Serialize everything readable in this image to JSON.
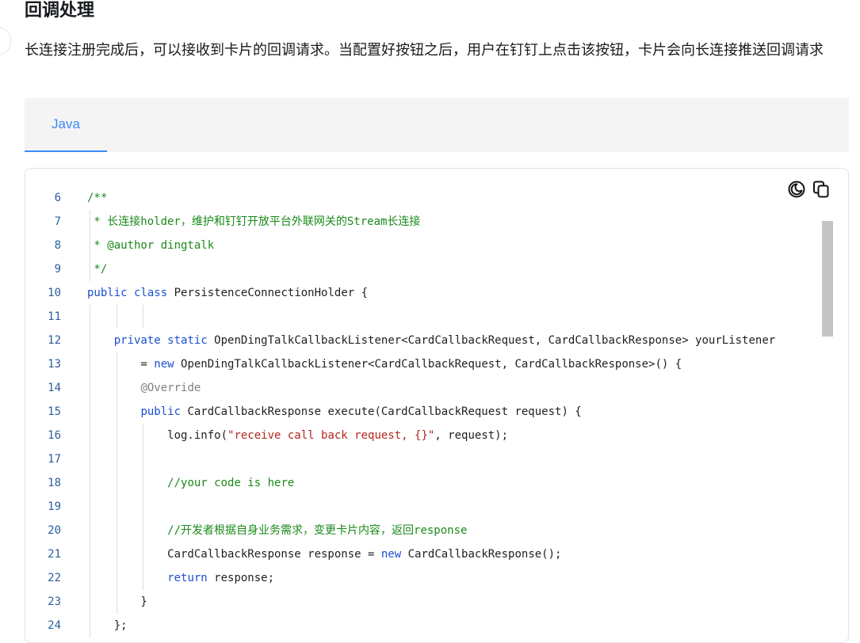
{
  "heading": "回调处理",
  "description": "长连接注册完成后，可以接收到卡片的回调请求。当配置好按钮之后，用户在钉钉上点击该按钮，卡片会向长连接推送回调请求",
  "tabs": [
    {
      "label": "Java",
      "active": true
    }
  ],
  "accent_color": "#3a8bf5",
  "toolbar": {
    "theme_icon": "theme-toggle-icon",
    "copy_icon": "copy-icon"
  },
  "code_lines": [
    {
      "n": "6",
      "tokens": [
        {
          "t": "/**",
          "c": "cm"
        }
      ]
    },
    {
      "n": "7",
      "tokens": [
        {
          "t": " * 长连接holder，维护和钉钉开放平台外联网关的Stream长连接",
          "c": "cm"
        }
      ]
    },
    {
      "n": "8",
      "tokens": [
        {
          "t": " * @author dingtalk",
          "c": "cm"
        }
      ]
    },
    {
      "n": "9",
      "tokens": [
        {
          "t": " */",
          "c": "cm"
        }
      ]
    },
    {
      "n": "10",
      "tokens": [
        {
          "t": "public",
          "c": "kw"
        },
        {
          "t": " "
        },
        {
          "t": "class",
          "c": "kw"
        },
        {
          "t": " PersistenceConnectionHolder {"
        }
      ]
    },
    {
      "n": "11",
      "tokens": []
    },
    {
      "n": "12",
      "tokens": [
        {
          "t": "    "
        },
        {
          "t": "private",
          "c": "kw"
        },
        {
          "t": " "
        },
        {
          "t": "static",
          "c": "kw"
        },
        {
          "t": " OpenDingTalkCallbackListener<CardCallbackRequest, CardCallbackResponse> yourListener"
        }
      ]
    },
    {
      "n": "13",
      "tokens": [
        {
          "t": "        = "
        },
        {
          "t": "new",
          "c": "kw"
        },
        {
          "t": " OpenDingTalkCallbackListener<CardCallbackRequest, CardCallbackResponse>() {"
        }
      ]
    },
    {
      "n": "14",
      "tokens": [
        {
          "t": "        "
        },
        {
          "t": "@Override",
          "c": "an"
        }
      ]
    },
    {
      "n": "15",
      "tokens": [
        {
          "t": "        "
        },
        {
          "t": "public",
          "c": "kw"
        },
        {
          "t": " CardCallbackResponse execute(CardCallbackRequest request) {"
        }
      ]
    },
    {
      "n": "16",
      "tokens": [
        {
          "t": "            log.info("
        },
        {
          "t": "\"receive call back request, {}\"",
          "c": "st"
        },
        {
          "t": ", request);"
        }
      ]
    },
    {
      "n": "17",
      "tokens": []
    },
    {
      "n": "18",
      "tokens": [
        {
          "t": "            "
        },
        {
          "t": "//your code is here",
          "c": "cm"
        }
      ]
    },
    {
      "n": "19",
      "tokens": []
    },
    {
      "n": "20",
      "tokens": [
        {
          "t": "            "
        },
        {
          "t": "//开发者根据自身业务需求，变更卡片内容，返回response",
          "c": "cm"
        }
      ]
    },
    {
      "n": "21",
      "tokens": [
        {
          "t": "            CardCallbackResponse response = "
        },
        {
          "t": "new",
          "c": "kw"
        },
        {
          "t": " CardCallbackResponse();"
        }
      ]
    },
    {
      "n": "22",
      "tokens": [
        {
          "t": "            "
        },
        {
          "t": "return",
          "c": "kw"
        },
        {
          "t": " response;"
        }
      ]
    },
    {
      "n": "23",
      "tokens": [
        {
          "t": "        }"
        }
      ]
    },
    {
      "n": "24",
      "tokens": [
        {
          "t": "    };"
        }
      ]
    }
  ]
}
